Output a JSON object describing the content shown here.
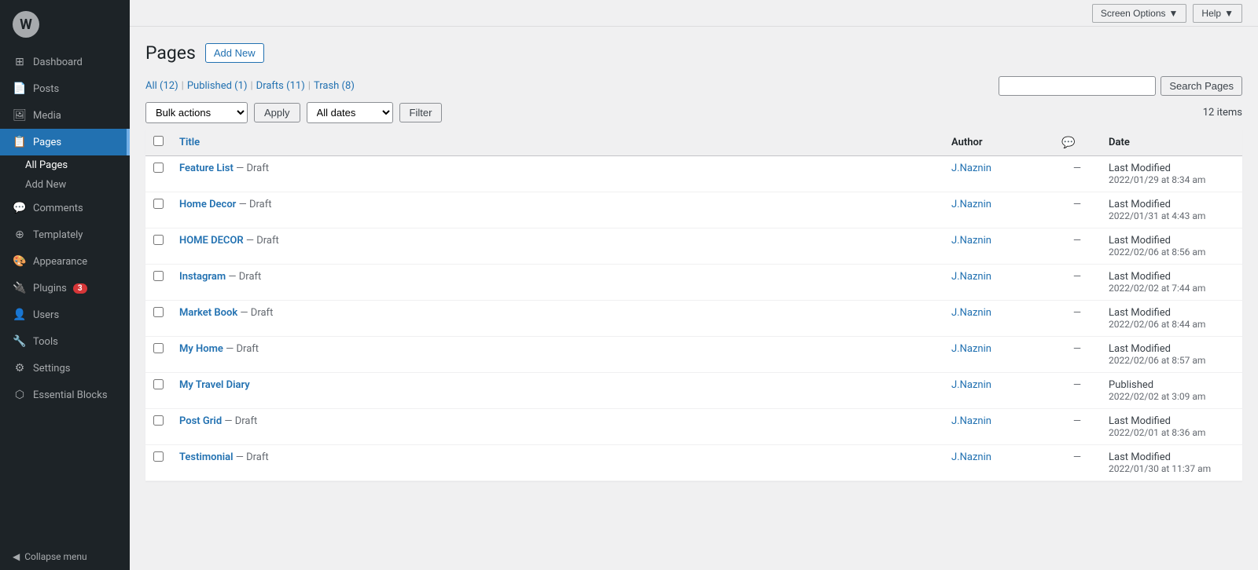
{
  "topbar": {
    "screen_options": "Screen Options",
    "help": "Help"
  },
  "sidebar": {
    "logo": "W",
    "items": [
      {
        "id": "dashboard",
        "label": "Dashboard",
        "icon": "⊞",
        "active": false
      },
      {
        "id": "posts",
        "label": "Posts",
        "icon": "📄",
        "active": false
      },
      {
        "id": "media",
        "label": "Media",
        "icon": "🖼",
        "active": false
      },
      {
        "id": "pages",
        "label": "Pages",
        "icon": "📋",
        "active": true
      },
      {
        "id": "comments",
        "label": "Comments",
        "icon": "💬",
        "active": false
      },
      {
        "id": "templately",
        "label": "Templately",
        "icon": "⊕",
        "active": false
      },
      {
        "id": "appearance",
        "label": "Appearance",
        "icon": "🎨",
        "active": false
      },
      {
        "id": "plugins",
        "label": "Plugins",
        "icon": "🔌",
        "active": false,
        "badge": "3"
      },
      {
        "id": "users",
        "label": "Users",
        "icon": "👤",
        "active": false
      },
      {
        "id": "tools",
        "label": "Tools",
        "icon": "🔧",
        "active": false
      },
      {
        "id": "settings",
        "label": "Settings",
        "icon": "⚙",
        "active": false
      },
      {
        "id": "essential-blocks",
        "label": "Essential Blocks",
        "icon": "⬡",
        "active": false
      }
    ],
    "sub_items": [
      {
        "id": "all-pages",
        "label": "All Pages",
        "active": true
      },
      {
        "id": "add-new",
        "label": "Add New",
        "active": false
      }
    ],
    "collapse_label": "Collapse menu"
  },
  "page": {
    "title": "Pages",
    "add_new": "Add New",
    "items_count": "12 items"
  },
  "filter_bar": {
    "all": "All",
    "all_count": "12",
    "published": "Published",
    "published_count": "1",
    "drafts": "Drafts",
    "drafts_count": "11",
    "trash": "Trash",
    "trash_count": "8"
  },
  "toolbar": {
    "bulk_actions_default": "Bulk actions",
    "apply": "Apply",
    "all_dates": "All dates",
    "filter": "Filter"
  },
  "search": {
    "placeholder": "",
    "button": "Search Pages"
  },
  "table": {
    "col_title": "Title",
    "col_author": "Author",
    "col_comments_icon": "💬",
    "col_date": "Date",
    "rows": [
      {
        "id": 1,
        "title": "Feature List",
        "status": "Draft",
        "author": "J.Naznin",
        "comments": "—",
        "date_status": "Last Modified",
        "date_value": "2022/01/29 at 8:34 am"
      },
      {
        "id": 2,
        "title": "Home Decor",
        "status": "Draft",
        "author": "J.Naznin",
        "comments": "—",
        "date_status": "Last Modified",
        "date_value": "2022/01/31 at 4:43 am"
      },
      {
        "id": 3,
        "title": "HOME DECOR",
        "status": "Draft",
        "author": "J.Naznin",
        "comments": "—",
        "date_status": "Last Modified",
        "date_value": "2022/02/06 at 8:56 am"
      },
      {
        "id": 4,
        "title": "Instagram",
        "status": "Draft",
        "author": "J.Naznin",
        "comments": "—",
        "date_status": "Last Modified",
        "date_value": "2022/02/02 at 7:44 am"
      },
      {
        "id": 5,
        "title": "Market Book",
        "status": "Draft",
        "author": "J.Naznin",
        "comments": "—",
        "date_status": "Last Modified",
        "date_value": "2022/02/06 at 8:44 am"
      },
      {
        "id": 6,
        "title": "My Home",
        "status": "Draft",
        "author": "J.Naznin",
        "comments": "—",
        "date_status": "Last Modified",
        "date_value": "2022/02/06 at 8:57 am"
      },
      {
        "id": 7,
        "title": "My Travel Diary",
        "status": "",
        "author": "J.Naznin",
        "comments": "—",
        "date_status": "Published",
        "date_value": "2022/02/02 at 3:09 am"
      },
      {
        "id": 8,
        "title": "Post Grid",
        "status": "Draft",
        "author": "J.Naznin",
        "comments": "—",
        "date_status": "Last Modified",
        "date_value": "2022/02/01 at 8:36 am"
      },
      {
        "id": 9,
        "title": "Testimonial",
        "status": "Draft",
        "author": "J.Naznin",
        "comments": "—",
        "date_status": "Last Modified",
        "date_value": "2022/01/30 at 11:37 am"
      }
    ]
  }
}
